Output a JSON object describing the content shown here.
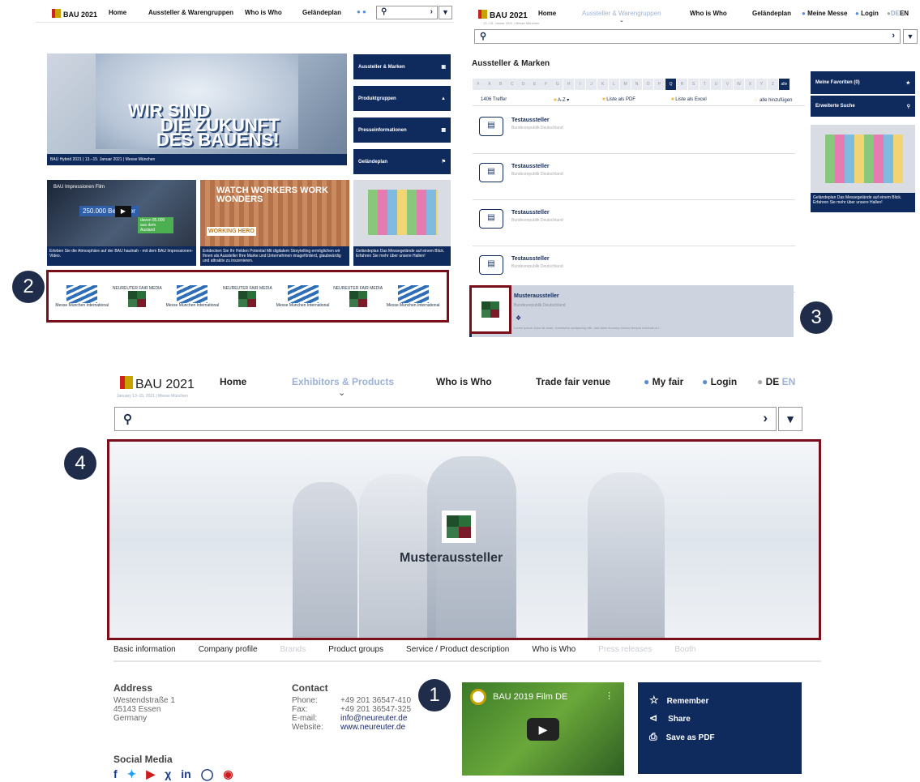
{
  "panel_a": {
    "logo": "BAU 2021",
    "nav": [
      "Home",
      "Aussteller & Warengruppen",
      "Who is Who",
      "Geländeplan"
    ],
    "hero_text": [
      "WIR SIND",
      "DIE ZUKUNFT",
      "DES BAUENS!"
    ],
    "hero_caption": "BAU Hybrid 2021 | 13.–15. Januar 2021 | Messe München",
    "side_buttons": [
      "Aussteller & Marken",
      "Produktgruppen",
      "Presseinformationen",
      "Geländeplan"
    ],
    "cards": [
      {
        "overlay": "BAU Impressionen Film",
        "stat": "250.000 Besucher",
        "stat2": "davon 85.000 aus dem Ausland",
        "caption": "Erleben Sie die Atmosphäre auf der BAU hautnah - mit dem BAU Impressionen-Video."
      },
      {
        "overlay": "WATCH WORKERS WORK WONDERS",
        "badge": "WORKING HERO",
        "caption": "Entdecken Sie Ihr Helden Potential Mit digitalem Storytelling ermöglichen wir Ihnen als Aussteller Ihre Marke und Unternehmen imageförderd, glaubwürdig und attraktiv zu inszenieren."
      },
      {
        "caption": "Geländeplan Das Messegelände auf einem Blick. Erfahren Sie mehr über unsere Hallen!"
      }
    ],
    "sponsors": [
      "Messe München International",
      "NEUREUTER FAIR MEDIA",
      "Messe München International",
      "NEUREUTER FAIR MEDIA",
      "Messe München International",
      "NEUREUTER FAIR MEDIA",
      "Messe München International"
    ]
  },
  "panel_b": {
    "logo": "BAU 2021",
    "sublogo": "13.–15. Januar 2021 | Messe München",
    "nav": [
      "Home",
      "Aussteller & Warengruppen",
      "Who is Who",
      "Geländeplan"
    ],
    "meine_messe": "Meine Messe",
    "login": "Login",
    "lang": [
      "DE",
      "EN"
    ],
    "section_title": "Aussteller & Marken",
    "letters": [
      "#",
      "A",
      "B",
      "C",
      "D",
      "E",
      "F",
      "G",
      "H",
      "I",
      "J",
      "K",
      "L",
      "M",
      "N",
      "O",
      "P",
      "Q",
      "R",
      "S",
      "T",
      "U",
      "V",
      "W",
      "X",
      "Y",
      "Z",
      "alle"
    ],
    "count": "1406 Treffer",
    "sort": "A-Z",
    "pdf": "Liste als PDF",
    "excel": "Liste als Excel",
    "add_all": "alle hinzufügen",
    "exhibitors": [
      {
        "name": "Testaussteller",
        "country": "Bundesrepublik Deutschland"
      },
      {
        "name": "Testaussteller",
        "country": "Bundesrepublik Deutschland"
      },
      {
        "name": "Testaussteller",
        "country": "Bundesrepublik Deutschland"
      },
      {
        "name": "Testaussteller",
        "country": "Bundesrepublik Deutschland"
      }
    ],
    "highlight": {
      "name": "Musteraussteller",
      "country": "Bundesrepublik Deutschland",
      "desc": "Lorem ipsum dolor sit amet, consetetur sadipscing elitr, sed diam nonumy eirmod tempor invidunt ut l..."
    },
    "favorites": "Meine Favoriten (0)",
    "advanced": "Erweiterte Suche",
    "map_caption": "Geländeplan Das Messegelände auf einem Blick. Erfahren Sie mehr über unsere Hallen!"
  },
  "panel_c": {
    "logo": "BAU 2021",
    "sublogo": "January 13–15, 2021 | Messe München",
    "nav": [
      "Home",
      "Exhibitors & Products",
      "Who is Who",
      "Trade fair venue"
    ],
    "my_fair": "My fair",
    "login": "Login",
    "lang": [
      "DE",
      "EN"
    ],
    "hero_name": "Musteraussteller",
    "tabs": [
      {
        "label": "Basic information",
        "active": true
      },
      {
        "label": "Company profile",
        "active": true
      },
      {
        "label": "Brands",
        "active": false
      },
      {
        "label": "Product groups",
        "active": true
      },
      {
        "label": "Service / Product description",
        "active": true
      },
      {
        "label": "Who is Who",
        "active": true
      },
      {
        "label": "Press releases",
        "active": false
      },
      {
        "label": "Booth",
        "active": false
      }
    ],
    "address": {
      "title": "Address",
      "lines": [
        "Westendstraße 1",
        "45143 Essen",
        "Germany"
      ]
    },
    "contact": {
      "title": "Contact",
      "rows": [
        {
          "k": "Phone:",
          "v": "+49 201 36547-410"
        },
        {
          "k": "Fax:",
          "v": "+49 201 36547-325"
        },
        {
          "k": "E-mail:",
          "v": "info@neureuter.de"
        },
        {
          "k": "Website:",
          "v": "www.neureuter.de"
        }
      ]
    },
    "social_title": "Social Media",
    "social": [
      "facebook-icon",
      "twitter-icon",
      "youtube-icon",
      "xing-icon",
      "linkedin-icon",
      "instagram-icon",
      "pinterest-icon"
    ],
    "video_title": "BAU 2019 Film DE",
    "actions": [
      "Remember",
      "Share",
      "Save as PDF"
    ]
  },
  "callouts": [
    "1",
    "2",
    "3",
    "4"
  ]
}
